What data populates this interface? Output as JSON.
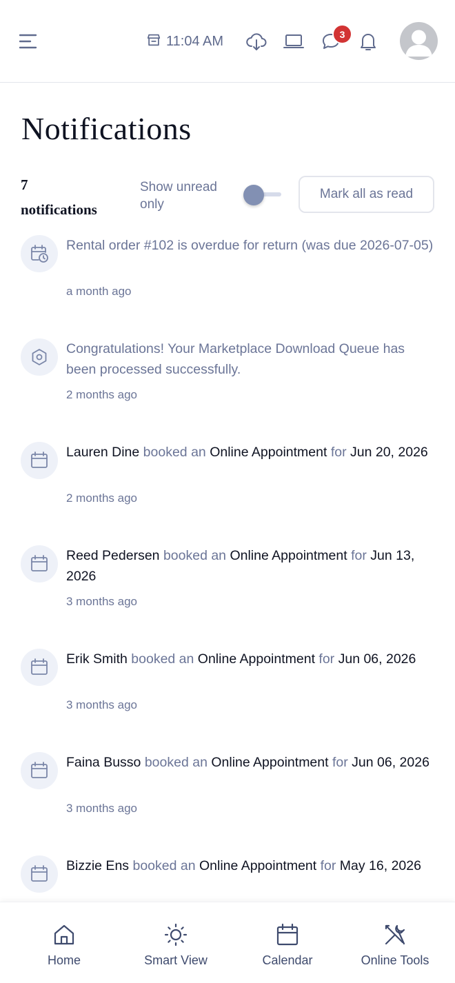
{
  "header": {
    "time": "11:04 AM",
    "chat_badge": "3",
    "icons": [
      "menu-icon",
      "store-icon",
      "cloud-download-icon",
      "laptop-icon",
      "chat-icon",
      "bell-icon",
      "avatar"
    ]
  },
  "page": {
    "title": "Notifications",
    "count_number": "7",
    "count_label": "notifications",
    "show_unread_label": "Show unread only",
    "show_unread_on": false,
    "mark_all_label": "Mark all as read"
  },
  "notifications": [
    {
      "icon": "calendar-clock-icon",
      "text": "Rental order #102 is overdue for return (was due 2026-07-05)",
      "time": "a month ago"
    },
    {
      "icon": "hexagon-icon",
      "text": "Congratulations! Your Marketplace Download Queue has been processed successfully.",
      "time": "2 months ago"
    },
    {
      "icon": "calendar-icon",
      "name": "Lauren Dine",
      "verb": "booked an",
      "item": "Online Appointment",
      "prep": "for",
      "date": "Jun 20, 2026",
      "time": "2 months ago"
    },
    {
      "icon": "calendar-icon",
      "name": "Reed Pedersen",
      "verb": "booked an",
      "item": "Online Appointment",
      "prep": "for",
      "date": "Jun 13, 2026",
      "time": "3 months ago"
    },
    {
      "icon": "calendar-icon",
      "name": "Erik Smith",
      "verb": "booked an",
      "item": "Online Appointment",
      "prep": "for",
      "date": "Jun 06, 2026",
      "time": "3 months ago"
    },
    {
      "icon": "calendar-icon",
      "name": "Faina Busso",
      "verb": "booked an",
      "item": "Online Appointment",
      "prep": "for",
      "date": "Jun 06, 2026",
      "time": "3 months ago"
    },
    {
      "icon": "calendar-icon",
      "name": "Bizzie Ens",
      "verb": "booked an",
      "item": "Online Appointment",
      "prep": "for",
      "date": "May 16, 2026"
    }
  ],
  "bottom_nav": [
    {
      "label": "Home",
      "icon": "home-icon"
    },
    {
      "label": "Smart View",
      "icon": "sun-icon"
    },
    {
      "label": "Calendar",
      "icon": "calendar-icon"
    },
    {
      "label": "Online Tools",
      "icon": "tools-icon"
    }
  ]
}
